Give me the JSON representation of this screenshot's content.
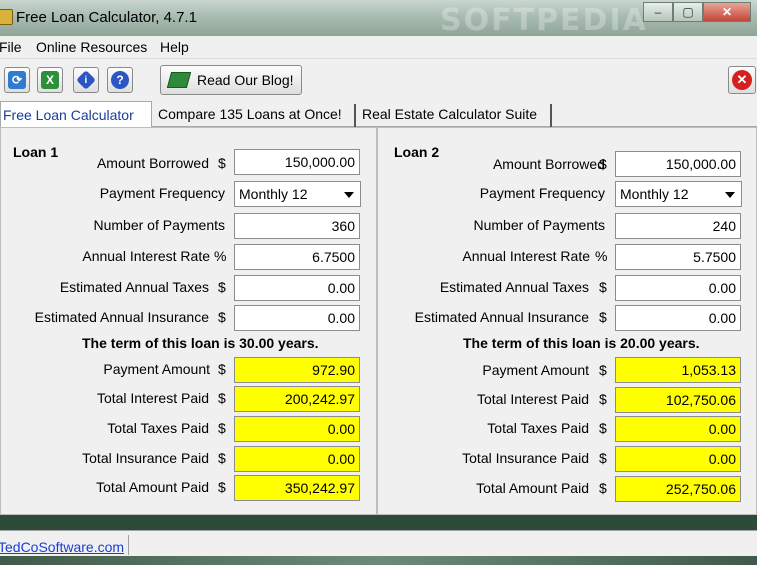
{
  "window": {
    "title": "Free Loan Calculator, 4.7.1",
    "watermark": "SOFTPEDIA"
  },
  "menu": {
    "file": "File",
    "online": "Online Resources",
    "help": "Help"
  },
  "toolbar": {
    "blog_label": "Read Our Blog!"
  },
  "tabs": [
    {
      "label": "Free Loan Calculator"
    },
    {
      "label": "Compare 135 Loans at Once!"
    },
    {
      "label": "Real Estate Calculator Suite"
    }
  ],
  "labels": {
    "amount_borrowed": "Amount Borrowed",
    "payment_frequency": "Payment Frequency",
    "number_of_payments": "Number of Payments",
    "annual_interest_rate": "Annual Interest Rate",
    "estimated_annual_taxes": "Estimated Annual Taxes",
    "estimated_annual_insurance": "Estimated Annual Insurance",
    "payment_amount": "Payment Amount",
    "total_interest_paid": "Total Interest Paid",
    "total_taxes_paid": "Total Taxes Paid",
    "total_insurance_paid": "Total Insurance Paid",
    "total_amount_paid": "Total Amount Paid",
    "dollar": "$",
    "percent": "%"
  },
  "loan1": {
    "title": "Loan 1",
    "amount_borrowed": "150,000.00",
    "payment_frequency": "Monthly 12",
    "number_of_payments": "360",
    "annual_interest_rate": "6.7500",
    "estimated_annual_taxes": "0.00",
    "estimated_annual_insurance": "0.00",
    "term": "The term of this loan is 30.00 years.",
    "payment_amount": "972.90",
    "total_interest_paid": "200,242.97",
    "total_taxes_paid": "0.00",
    "total_insurance_paid": "0.00",
    "total_amount_paid": "350,242.97"
  },
  "loan2": {
    "title": "Loan 2",
    "amount_borrowed": "150,000.00",
    "payment_frequency": "Monthly 12",
    "number_of_payments": "240",
    "annual_interest_rate": "5.7500",
    "estimated_annual_taxes": "0.00",
    "estimated_annual_insurance": "0.00",
    "term": "The term of this loan is 20.00 years.",
    "payment_amount": "1,053.13",
    "total_interest_paid": "102,750.06",
    "total_taxes_paid": "0.00",
    "total_insurance_paid": "0.00",
    "total_amount_paid": "252,750.06"
  },
  "status": {
    "link": "TedCoSoftware.com"
  },
  "colors": {
    "result_fill": "#ffff00",
    "active_tab_text": "#1a3d9c",
    "link": "#1a3dd6"
  },
  "icons": [
    "refresh-icon",
    "excel-icon",
    "info-icon",
    "help-icon",
    "blog-book-icon",
    "exit-icon"
  ]
}
